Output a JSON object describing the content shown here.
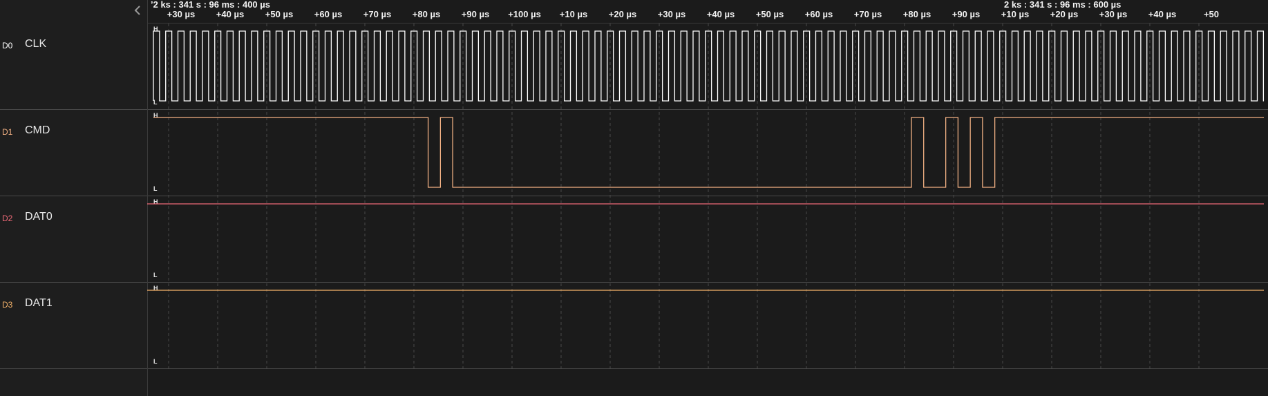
{
  "colors": {
    "background": "#1b1b1b",
    "clk": "#ffffff",
    "cmd": "#f2b184",
    "dat0": "#f06a78",
    "dat1": "#f5b36a",
    "grid": "#4a4a4a"
  },
  "ruler": {
    "abs_left": "’2 ks : 341 s : 96 ms : 400 µs",
    "abs_right": "2 ks : 341 s : 96 ms : 600 µs",
    "ticks": [
      "+30 µs",
      "+40 µs",
      "+50 µs",
      "+60 µs",
      "+70 µs",
      "+80 µs",
      "+90 µs",
      "+100 µs",
      "+10 µs",
      "+20 µs",
      "+30 µs",
      "+40 µs",
      "+50 µs",
      "+60 µs",
      "+70 µs",
      "+80 µs",
      "+90 µs",
      "+10 µs",
      "+20 µs",
      "+30 µs",
      "+40 µs",
      "+50"
    ]
  },
  "collapse_icon": "chevron-left-icon",
  "channels": [
    {
      "id": "D0",
      "name": "CLK",
      "high_label": "H",
      "low_label": "L"
    },
    {
      "id": "D1",
      "name": "CMD",
      "high_label": "H",
      "low_label": "L"
    },
    {
      "id": "D2",
      "name": "DAT0",
      "high_label": "H",
      "low_label": "L"
    },
    {
      "id": "D3",
      "name": "DAT1",
      "high_label": "H",
      "low_label": "L"
    }
  ],
  "signals": {
    "clk": {
      "period_us": 2.5,
      "start_us": 22.5
    },
    "cmd": {
      "initial": 1,
      "transitions_us": [
        78.5,
        81.0,
        83.5,
        177.0,
        179.5,
        184.0,
        186.5,
        189.0,
        191.5,
        194.0
      ]
    },
    "dat0": {
      "level": 1
    },
    "dat1": {
      "level": 1
    }
  },
  "view": {
    "start_us": 22.5,
    "end_us": 250.0
  }
}
